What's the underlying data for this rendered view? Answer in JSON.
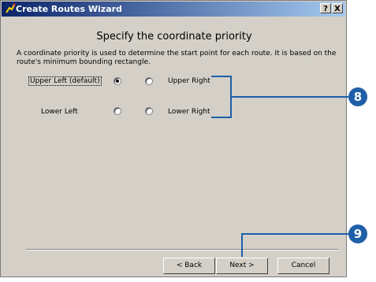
{
  "window": {
    "title": "Create Routes Wizard",
    "help_btn": "?",
    "close_btn": "X"
  },
  "content": {
    "heading": "Specify the coordinate priority",
    "description": "A coordinate priority is used to determine the start point for each route.  It is based on the route's minimum bounding rectangle."
  },
  "options": {
    "upper_left": {
      "label": "Upper Left (default)",
      "selected": true
    },
    "upper_right": {
      "label": "Upper Right",
      "selected": false
    },
    "lower_left": {
      "label": "Lower Left",
      "selected": false
    },
    "lower_right": {
      "label": "Lower Right",
      "selected": false
    }
  },
  "buttons": {
    "back": "< Back",
    "next": "Next >",
    "cancel": "Cancel"
  },
  "callouts": {
    "step8": "8",
    "step9": "9"
  },
  "colors": {
    "callout": "#1f5fa8",
    "title_start": "#0a246a",
    "title_end": "#a6caf0"
  }
}
